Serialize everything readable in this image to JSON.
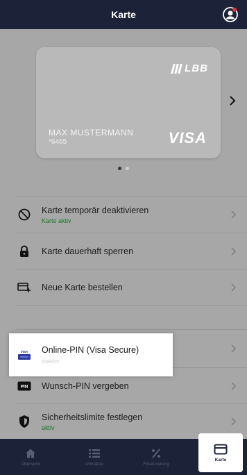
{
  "header": {
    "title": "Karte",
    "profile_icon": "profile-icon"
  },
  "card": {
    "bank_logo": "LBB",
    "holder_name": "MAX MUSTERMANN",
    "number": "*6465",
    "network": "VISA",
    "pager": {
      "pages": 2,
      "active": 1
    }
  },
  "menu": {
    "items": [
      {
        "label": "Karte temporär deaktivieren",
        "status": "Karte aktiv",
        "icon": "block-icon"
      },
      {
        "label": "Karte dauerhaft sperren",
        "status": "",
        "icon": "lock-icon"
      },
      {
        "label": "Neue Karte bestellen",
        "status": "",
        "icon": "new-card-icon"
      },
      {
        "label": "Online-PIN (Visa Secure)",
        "status": "inaktiv",
        "icon": "visa-secure-icon"
      },
      {
        "label": "Wunsch-PIN vergeben",
        "status": "",
        "icon": "pin-icon"
      },
      {
        "label": "Sicherheitslimite festlegen",
        "status": "aktiv",
        "icon": "shield-icon"
      }
    ]
  },
  "tabbar": {
    "tabs": [
      {
        "label": "Übersicht",
        "icon": "home-icon"
      },
      {
        "label": "Umsätze",
        "icon": "list-icon"
      },
      {
        "label": "Finanzierung",
        "icon": "percent-icon"
      },
      {
        "label": "Karte",
        "icon": "card-icon",
        "active": true
      }
    ]
  },
  "colors": {
    "header": "#1c2238",
    "status_green": "#1a7a2a",
    "overlay": "#a7a7a7"
  }
}
